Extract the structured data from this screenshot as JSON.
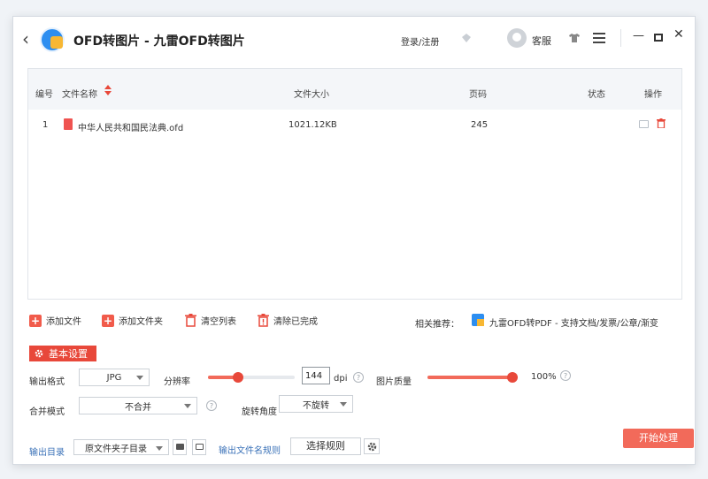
{
  "titlebar": {
    "title": "OFD转图片 - 九雷OFD转图片",
    "login": "登录/注册",
    "support": "客服"
  },
  "table": {
    "headers": {
      "index": "编号",
      "name": "文件名称",
      "size": "文件大小",
      "pages": "页码",
      "status": "状态",
      "actions": "操作"
    },
    "rows": [
      {
        "index": "1",
        "name": "中华人民共和国民法典.ofd",
        "size": "1021.12KB",
        "pages": "245",
        "status": ""
      }
    ]
  },
  "actions": {
    "add_file": "添加文件",
    "add_folder": "添加文件夹",
    "clear_list": "清空列表",
    "clear_done": "清除已完成",
    "recommend_label": "相关推荐：",
    "recommend_text": "九雷OFD转PDF - 支持文档/发票/公章/渐变"
  },
  "settings": {
    "section_label": "基本设置",
    "output_format_label": "输出格式",
    "output_format_value": "JPG",
    "resolution_label": "分辨率",
    "resolution_value": "144",
    "resolution_unit": "dpi",
    "resolution_level": 0.35,
    "quality_label": "图片质量",
    "quality_value": "100%",
    "quality_level": 1.0,
    "merge_label": "合并模式",
    "merge_value": "不合并",
    "rotate_label": "旋转角度",
    "rotate_value": "不旋转"
  },
  "output": {
    "dir_label": "输出目录",
    "dir_value": "原文件夹子目录",
    "rule_label": "输出文件名规则",
    "rule_button": "选择规则",
    "start_button": "开始处理"
  },
  "colors": {
    "accent": "#e8483a",
    "link": "#3b72b8"
  }
}
